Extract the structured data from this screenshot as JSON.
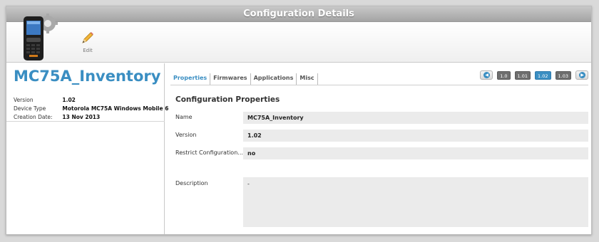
{
  "window": {
    "title": "Configuration Details"
  },
  "toolbar": {
    "edit_label": "Edit"
  },
  "device": {
    "name": "MC75A_Inventory",
    "meta": [
      {
        "key": "Version",
        "value": "1.02"
      },
      {
        "key": "Device Type",
        "value": "Motorola MC75A Windows Mobile 6"
      },
      {
        "key": "Creation Date:",
        "value": "13 Nov 2013"
      }
    ]
  },
  "tabs": [
    {
      "label": "Properties",
      "active": true
    },
    {
      "label": "Firmwares",
      "active": false
    },
    {
      "label": "Applications",
      "active": false
    },
    {
      "label": "Misc",
      "active": false
    }
  ],
  "versions": {
    "items": [
      "1.0",
      "1.01",
      "1.02",
      "1.03"
    ],
    "current": "1.02"
  },
  "properties": {
    "section_title": "Configuration Properties",
    "rows": [
      {
        "label": "Name",
        "value": "MC75A_Inventory"
      },
      {
        "label": "Version",
        "value": "1.02"
      },
      {
        "label": "Restrict Configuration...",
        "value": "no"
      }
    ],
    "description_label": "Description",
    "description_value": "-"
  },
  "icons": {
    "device": "mobile-device-gear-icon",
    "edit": "pencil-icon",
    "prev": "arrow-left-icon",
    "next": "arrow-right-icon"
  },
  "colors": {
    "accent": "#3a8ec2",
    "titlebar": "#b0b0b0",
    "version_badge": "#6e6e6e"
  }
}
